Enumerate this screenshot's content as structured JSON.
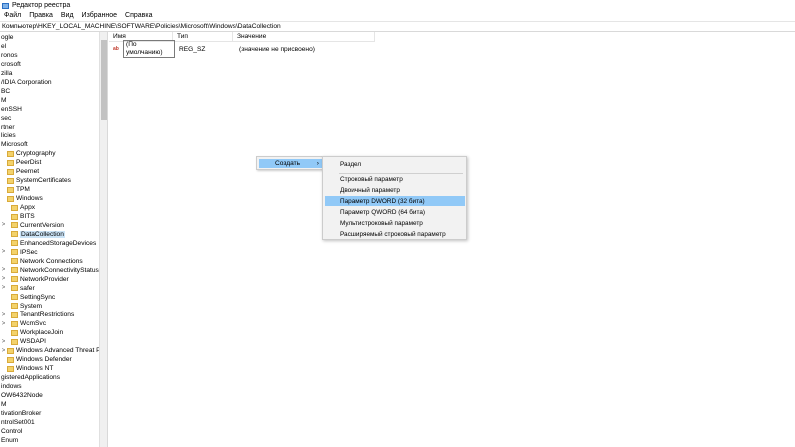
{
  "window": {
    "title": "Редактор реестра"
  },
  "menu": [
    "Файл",
    "Правка",
    "Вид",
    "Избранное",
    "Справка"
  ],
  "address": "Компьютер\\HKEY_LOCAL_MACHINE\\SOFTWARE\\Policies\\Microsoft\\Windows\\DataCollection",
  "tree": [
    {
      "label": "ogle",
      "indent": 0,
      "folder": false,
      "expander": ""
    },
    {
      "label": "el",
      "indent": 0,
      "folder": false,
      "expander": ""
    },
    {
      "label": "ronos",
      "indent": 0,
      "folder": false,
      "expander": ""
    },
    {
      "label": "crosoft",
      "indent": 0,
      "folder": false,
      "expander": ""
    },
    {
      "label": "zilla",
      "indent": 0,
      "folder": false,
      "expander": ""
    },
    {
      "label": "/IDIA Corporation",
      "indent": 0,
      "folder": false,
      "expander": ""
    },
    {
      "label": "BC",
      "indent": 0,
      "folder": false,
      "expander": ""
    },
    {
      "label": "M",
      "indent": 0,
      "folder": false,
      "expander": ""
    },
    {
      "label": "enSSH",
      "indent": 0,
      "folder": false,
      "expander": ""
    },
    {
      "label": "sec",
      "indent": 0,
      "folder": false,
      "expander": ""
    },
    {
      "label": "rtner",
      "indent": 0,
      "folder": false,
      "expander": ""
    },
    {
      "label": "licies",
      "indent": 0,
      "folder": false,
      "expander": ""
    },
    {
      "label": "Microsoft",
      "indent": 0,
      "folder": false,
      "expander": ""
    },
    {
      "label": "Cryptography",
      "indent": 1,
      "folder": true,
      "expander": ""
    },
    {
      "label": "PeerDist",
      "indent": 1,
      "folder": true,
      "expander": ""
    },
    {
      "label": "Peernet",
      "indent": 1,
      "folder": true,
      "expander": ""
    },
    {
      "label": "SystemCertificates",
      "indent": 1,
      "folder": true,
      "expander": ""
    },
    {
      "label": "TPM",
      "indent": 1,
      "folder": true,
      "expander": ""
    },
    {
      "label": "Windows",
      "indent": 1,
      "folder": true,
      "expander": ""
    },
    {
      "label": "Appx",
      "indent": 2,
      "folder": true,
      "expander": ""
    },
    {
      "label": "BITS",
      "indent": 2,
      "folder": true,
      "expander": ""
    },
    {
      "label": "CurrentVersion",
      "indent": 2,
      "folder": true,
      "expander": ">"
    },
    {
      "label": "DataCollection",
      "indent": 2,
      "folder": true,
      "expander": "",
      "selected": true
    },
    {
      "label": "EnhancedStorageDevices",
      "indent": 2,
      "folder": true,
      "expander": ""
    },
    {
      "label": "IPSec",
      "indent": 2,
      "folder": true,
      "expander": ">"
    },
    {
      "label": "Network Connections",
      "indent": 2,
      "folder": true,
      "expander": ""
    },
    {
      "label": "NetworkConnectivityStatusInd",
      "indent": 2,
      "folder": true,
      "expander": ">"
    },
    {
      "label": "NetworkProvider",
      "indent": 2,
      "folder": true,
      "expander": ">"
    },
    {
      "label": "safer",
      "indent": 2,
      "folder": true,
      "expander": ">"
    },
    {
      "label": "SettingSync",
      "indent": 2,
      "folder": true,
      "expander": ""
    },
    {
      "label": "System",
      "indent": 2,
      "folder": true,
      "expander": ""
    },
    {
      "label": "TenantRestrictions",
      "indent": 2,
      "folder": true,
      "expander": ">"
    },
    {
      "label": "WcmSvc",
      "indent": 2,
      "folder": true,
      "expander": ">"
    },
    {
      "label": "WorkplaceJoin",
      "indent": 2,
      "folder": true,
      "expander": ""
    },
    {
      "label": "WSDAPI",
      "indent": 2,
      "folder": true,
      "expander": ">"
    },
    {
      "label": "Windows Advanced Threat Protec",
      "indent": 1,
      "folder": true,
      "expander": ">"
    },
    {
      "label": "Windows Defender",
      "indent": 1,
      "folder": true,
      "expander": ""
    },
    {
      "label": "Windows NT",
      "indent": 1,
      "folder": true,
      "expander": ""
    },
    {
      "label": "gisteredApplications",
      "indent": 0,
      "folder": false,
      "expander": ""
    },
    {
      "label": "indows",
      "indent": 0,
      "folder": false,
      "expander": ""
    },
    {
      "label": "OW6432Node",
      "indent": 0,
      "folder": false,
      "expander": ""
    },
    {
      "label": "M",
      "indent": 0,
      "folder": false,
      "expander": ""
    },
    {
      "label": "tivationBroker",
      "indent": 0,
      "folder": false,
      "expander": ""
    },
    {
      "label": "ntrolSet001",
      "indent": 0,
      "folder": false,
      "expander": ""
    },
    {
      "label": "Control",
      "indent": 0,
      "folder": false,
      "expander": ""
    },
    {
      "label": "Enum",
      "indent": 0,
      "folder": false,
      "expander": ""
    }
  ],
  "columns": {
    "name": "Имя",
    "type": "Тип",
    "value": "Значение"
  },
  "values": [
    {
      "icon": "ab",
      "name": "(По умолчанию)",
      "type": "REG_SZ",
      "data": "(значение не присвоено)"
    }
  ],
  "context_menu": {
    "create_label": "Создать",
    "create_arrow": "›",
    "items": [
      {
        "label": "Раздел",
        "highlighted": false
      },
      {
        "label": "Строковый параметр",
        "highlighted": false
      },
      {
        "label": "Двоичный параметр",
        "highlighted": false
      },
      {
        "label": "Параметр DWORD (32 бита)",
        "highlighted": true
      },
      {
        "label": "Параметр QWORD (64 бита)",
        "highlighted": false
      },
      {
        "label": "Мультистроковый параметр",
        "highlighted": false
      },
      {
        "label": "Расширяемый строковый параметр",
        "highlighted": false
      }
    ]
  }
}
